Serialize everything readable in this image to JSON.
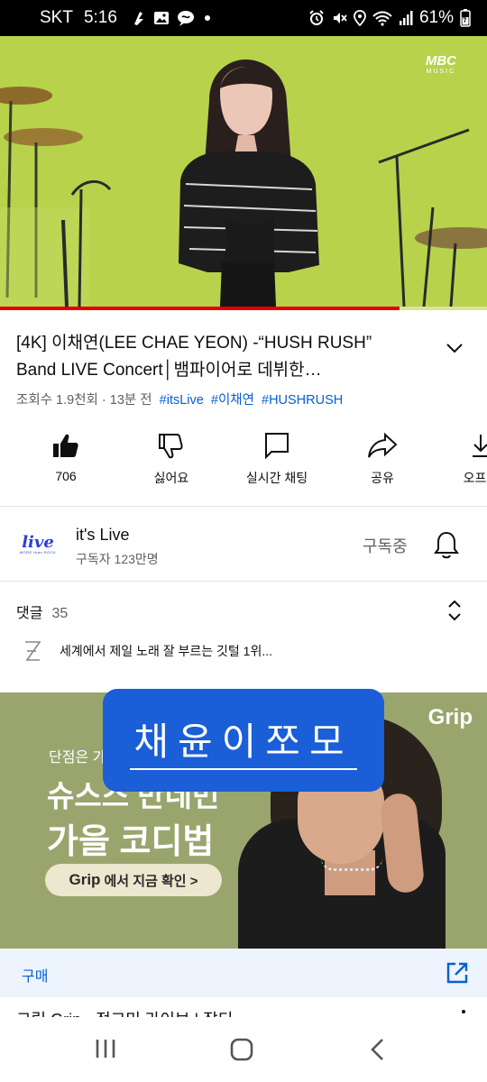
{
  "status_bar": {
    "carrier": "SKT",
    "time": "5:16",
    "battery": "61%",
    "icons": [
      "bixby-icon",
      "gallery-icon",
      "chat-bubble-icon",
      "dot-icon",
      "alarm-icon",
      "mute-icon",
      "location-icon",
      "wifi-icon",
      "signal-icon",
      "battery-icon"
    ]
  },
  "video": {
    "watermark_brand": "MBC",
    "watermark_sub": "MUSIC",
    "progress_fraction": 0.82,
    "progress_color": "#e00000"
  },
  "title": {
    "text": "[4K] 이채연(LEE CHAE YEON) -“HUSH RUSH” Band LIVE Concert│뱀파이어로 데뷔한…"
  },
  "meta": {
    "views": "조회수 1.9천회",
    "separator": "·",
    "time_ago": "13분 전",
    "tags": [
      "#itsLive",
      "#이채연",
      "#HUSHRUSH"
    ]
  },
  "actions": [
    {
      "icon": "thumbs-up-icon",
      "label": "706"
    },
    {
      "icon": "thumbs-down-icon",
      "label": "싫어요"
    },
    {
      "icon": "live-chat-icon",
      "label": "실시간 채팅"
    },
    {
      "icon": "share-icon",
      "label": "공유"
    },
    {
      "icon": "offline-icon",
      "label": "오프라"
    }
  ],
  "channel": {
    "avatar_text": "live",
    "avatar_sub": "MORE than ROCK",
    "name": "it's Live",
    "subscribers": "구독자 123만명",
    "subscribe_state": "구독중"
  },
  "comments": {
    "label": "댓글",
    "count": "35",
    "top_comment": "세계에서 제일 노래 잘 부르는 깃털 1위..."
  },
  "ad": {
    "brand": "Grip",
    "subtitle": "단점은 가",
    "headline_1": "슈스스 만네번",
    "headline_2": "가을 코디법",
    "cta_brand": "Grip",
    "cta_text": "에서 지금 확인 >",
    "buy_label": "구매",
    "next_title": "그립 Grip · 정고민 라이브 | 잡티"
  },
  "sticker": {
    "text": "채윤이쪼모"
  },
  "navbar": {
    "buttons": [
      "recent-apps-icon",
      "home-icon",
      "back-icon"
    ]
  }
}
